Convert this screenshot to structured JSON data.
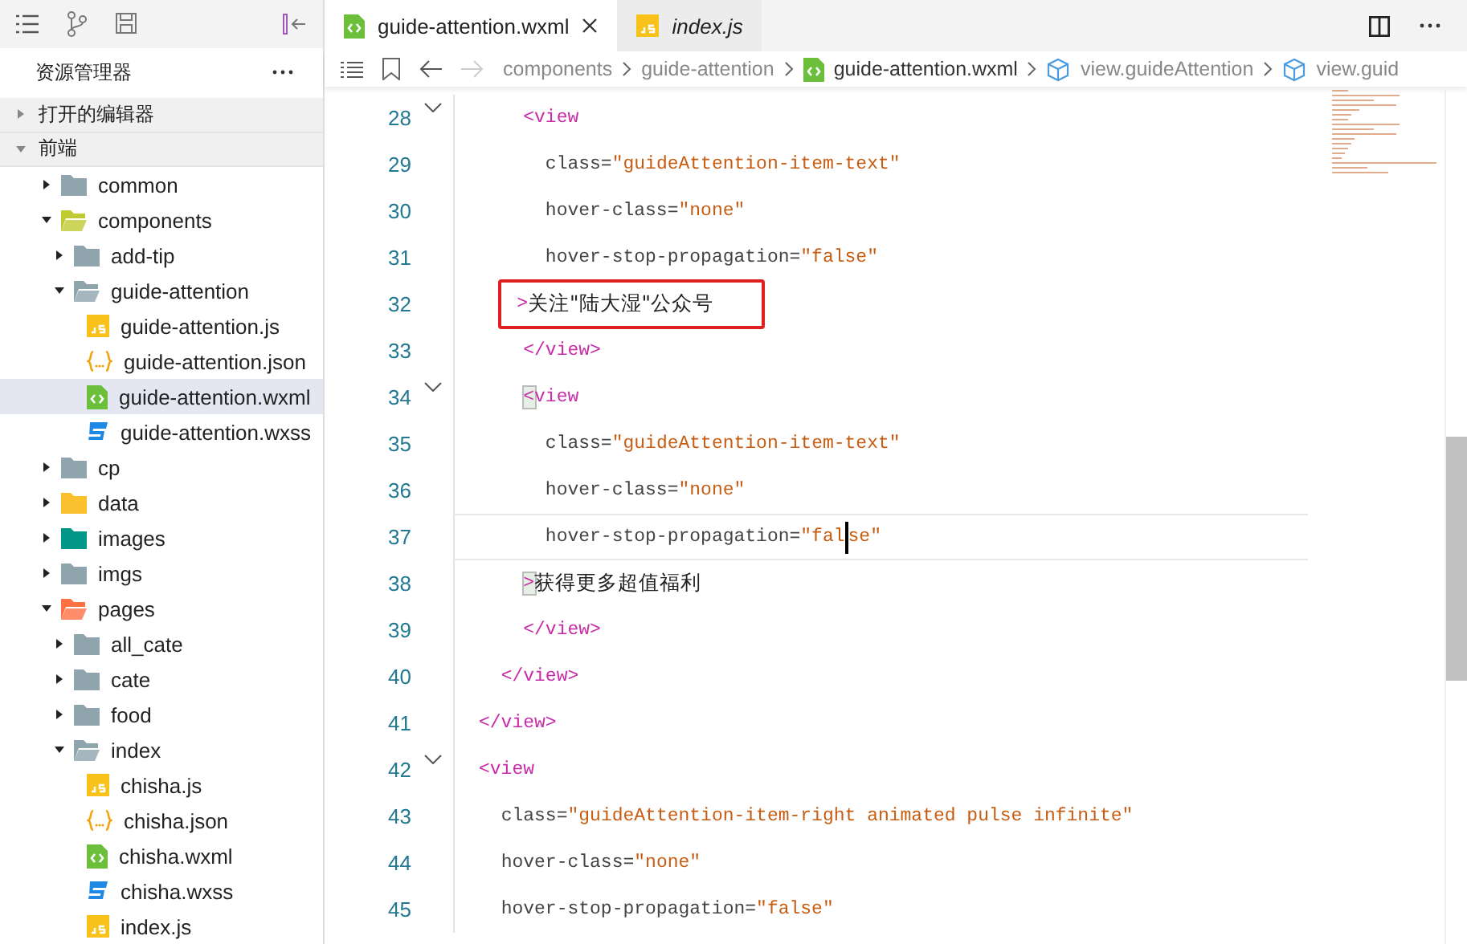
{
  "sidebar": {
    "title": "资源管理器",
    "sections": [
      {
        "label": "打开的编辑器",
        "expanded": false
      },
      {
        "label": "前端",
        "expanded": true
      }
    ],
    "tree": [
      {
        "label": "common",
        "kind": "folder",
        "color": "#90a4ae",
        "expanded": false
      },
      {
        "label": "components",
        "kind": "folder",
        "color": "#c0ca33",
        "expanded": true,
        "children": [
          {
            "label": "add-tip",
            "kind": "folder",
            "color": "#90a4ae",
            "expanded": false
          },
          {
            "label": "guide-attention",
            "kind": "folder",
            "color": "#90a4ae",
            "expanded": true,
            "children": [
              {
                "label": "guide-attention.js",
                "kind": "js",
                "selected": false
              },
              {
                "label": "guide-attention.json",
                "kind": "json",
                "selected": false
              },
              {
                "label": "guide-attention.wxml",
                "kind": "wxml",
                "selected": true
              },
              {
                "label": "guide-attention.wxss",
                "kind": "wxss",
                "selected": false
              }
            ]
          }
        ]
      },
      {
        "label": "cp",
        "kind": "folder",
        "color": "#90a4ae",
        "expanded": false
      },
      {
        "label": "data",
        "kind": "folder",
        "color": "#fbc02d",
        "expanded": false
      },
      {
        "label": "images",
        "kind": "folder",
        "color": "#009688",
        "expanded": false
      },
      {
        "label": "imgs",
        "kind": "folder",
        "color": "#90a4ae",
        "expanded": false
      },
      {
        "label": "pages",
        "kind": "folder",
        "color": "#ff7043",
        "expanded": true,
        "children": [
          {
            "label": "all_cate",
            "kind": "folder",
            "color": "#90a4ae",
            "expanded": false
          },
          {
            "label": "cate",
            "kind": "folder",
            "color": "#90a4ae",
            "expanded": false
          },
          {
            "label": "food",
            "kind": "folder",
            "color": "#90a4ae",
            "expanded": false
          },
          {
            "label": "index",
            "kind": "folder",
            "color": "#90a4ae",
            "expanded": true,
            "children": [
              {
                "label": "chisha.js",
                "kind": "js",
                "selected": false
              },
              {
                "label": "chisha.json",
                "kind": "json",
                "selected": false
              },
              {
                "label": "chisha.wxml",
                "kind": "wxml",
                "selected": false
              },
              {
                "label": "chisha.wxss",
                "kind": "wxss",
                "selected": false
              },
              {
                "label": "index.js",
                "kind": "js",
                "selected": false
              }
            ]
          }
        ]
      }
    ]
  },
  "tabs": [
    {
      "label": "guide-attention.wxml",
      "kind": "wxml",
      "selected": true,
      "preview": false
    },
    {
      "label": "index.js",
      "kind": "js",
      "selected": false,
      "preview": true
    }
  ],
  "breadcrumb": [
    {
      "label": "components",
      "kind": "folder"
    },
    {
      "label": "guide-attention",
      "kind": "folder"
    },
    {
      "label": "guide-attention.wxml",
      "kind": "wxml"
    },
    {
      "label": "view.guideAttention",
      "kind": "element"
    },
    {
      "label": "view.guid",
      "kind": "element"
    }
  ],
  "code": [
    {
      "number": "28",
      "foldable": true,
      "tokens": [
        {
          "kind": "tag",
          "text": "    <view"
        }
      ]
    },
    {
      "number": "29",
      "tokens": [
        {
          "kind": "attr",
          "text": "      class="
        },
        {
          "kind": "string",
          "text": "\"guideAttention-item-text\""
        }
      ]
    },
    {
      "number": "30",
      "tokens": [
        {
          "kind": "attr",
          "text": "      hover-class="
        },
        {
          "kind": "string",
          "text": "\"none\""
        }
      ]
    },
    {
      "number": "31",
      "tokens": [
        {
          "kind": "attr",
          "text": "      hover-stop-propagation="
        },
        {
          "kind": "string",
          "text": "\"false\""
        }
      ]
    },
    {
      "number": "32",
      "highlighted": true,
      "tokens": [
        {
          "kind": "tag",
          "text": "    >"
        },
        {
          "kind": "text",
          "text": "关注\"陆大湿\"公众号"
        }
      ]
    },
    {
      "number": "33",
      "tokens": [
        {
          "kind": "tag",
          "text": "    </view>"
        }
      ]
    },
    {
      "number": "34",
      "foldable": true,
      "tokens": [
        {
          "kind": "bracket",
          "text": "    <"
        },
        {
          "kind": "tag",
          "text": "view"
        }
      ]
    },
    {
      "number": "35",
      "tokens": [
        {
          "kind": "attr",
          "text": "      class="
        },
        {
          "kind": "string",
          "text": "\"guideAttention-item-text\""
        }
      ]
    },
    {
      "number": "36",
      "tokens": [
        {
          "kind": "attr",
          "text": "      hover-class="
        },
        {
          "kind": "string",
          "text": "\"none\""
        }
      ]
    },
    {
      "number": "37",
      "current": true,
      "tokens": [
        {
          "kind": "attr",
          "text": "      hover-stop-propagation="
        },
        {
          "kind": "string",
          "text": "\"fal"
        },
        {
          "kind": "cursor"
        },
        {
          "kind": "string",
          "text": "se\""
        }
      ]
    },
    {
      "number": "38",
      "tokens": [
        {
          "kind": "bracket",
          "text": "    >"
        },
        {
          "kind": "text",
          "text": "获得更多超值福利"
        }
      ]
    },
    {
      "number": "39",
      "tokens": [
        {
          "kind": "tag",
          "text": "    </view>"
        }
      ]
    },
    {
      "number": "40",
      "tokens": [
        {
          "kind": "tag",
          "text": "  </view>"
        }
      ]
    },
    {
      "number": "41",
      "tokens": [
        {
          "kind": "tag",
          "text": "</view>"
        }
      ]
    },
    {
      "number": "42",
      "foldable": true,
      "tokens": [
        {
          "kind": "tag",
          "text": "<view"
        }
      ]
    },
    {
      "number": "43",
      "tokens": [
        {
          "kind": "attr",
          "text": "  class="
        },
        {
          "kind": "string",
          "text": "\"guideAttention-item-right animated pulse infinite\""
        }
      ]
    },
    {
      "number": "44",
      "tokens": [
        {
          "kind": "attr",
          "text": "  hover-class="
        },
        {
          "kind": "string",
          "text": "\"none\""
        }
      ]
    },
    {
      "number": "45",
      "tokens": [
        {
          "kind": "attr",
          "text": "  hover-stop-propagation="
        },
        {
          "kind": "string",
          "text": "\"false\""
        }
      ]
    }
  ]
}
